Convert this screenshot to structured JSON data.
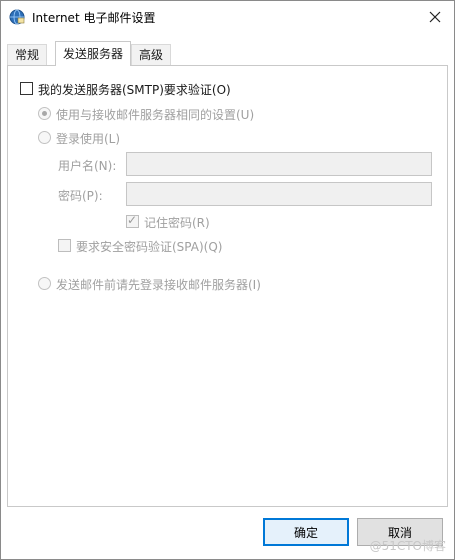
{
  "window": {
    "title": "Internet 电子邮件设置"
  },
  "tabs": [
    {
      "label": "常规",
      "active": false
    },
    {
      "label": "发送服务器",
      "active": true
    },
    {
      "label": "高级",
      "active": false
    }
  ],
  "outgoing": {
    "smtp_auth_label": "我的发送服务器(SMTP)要求验证(O)",
    "smtp_auth_checked": false,
    "use_same_settings_label": "使用与接收邮件服务器相同的设置(U)",
    "use_same_settings_selected": true,
    "log_on_using_label": "登录使用(L)",
    "log_on_using_selected": false,
    "username_label": "用户名(N):",
    "username_value": "",
    "password_label": "密码(P):",
    "password_value": "",
    "remember_password_label": "记住密码(R)",
    "remember_password_checked": true,
    "spa_label": "要求安全密码验证(SPA)(Q)",
    "spa_checked": false,
    "log_on_before_send_label": "发送邮件前请先登录接收邮件服务器(I)",
    "log_on_before_send_selected": false
  },
  "buttons": {
    "ok_label": "确定",
    "cancel_label": "取消"
  },
  "watermark": "@51CTO博客",
  "colors": {
    "accent": "#0078d7",
    "disabled_text": "#a0a0a0"
  },
  "icons": {
    "title": "globe-mail-icon",
    "close": "close-icon"
  }
}
